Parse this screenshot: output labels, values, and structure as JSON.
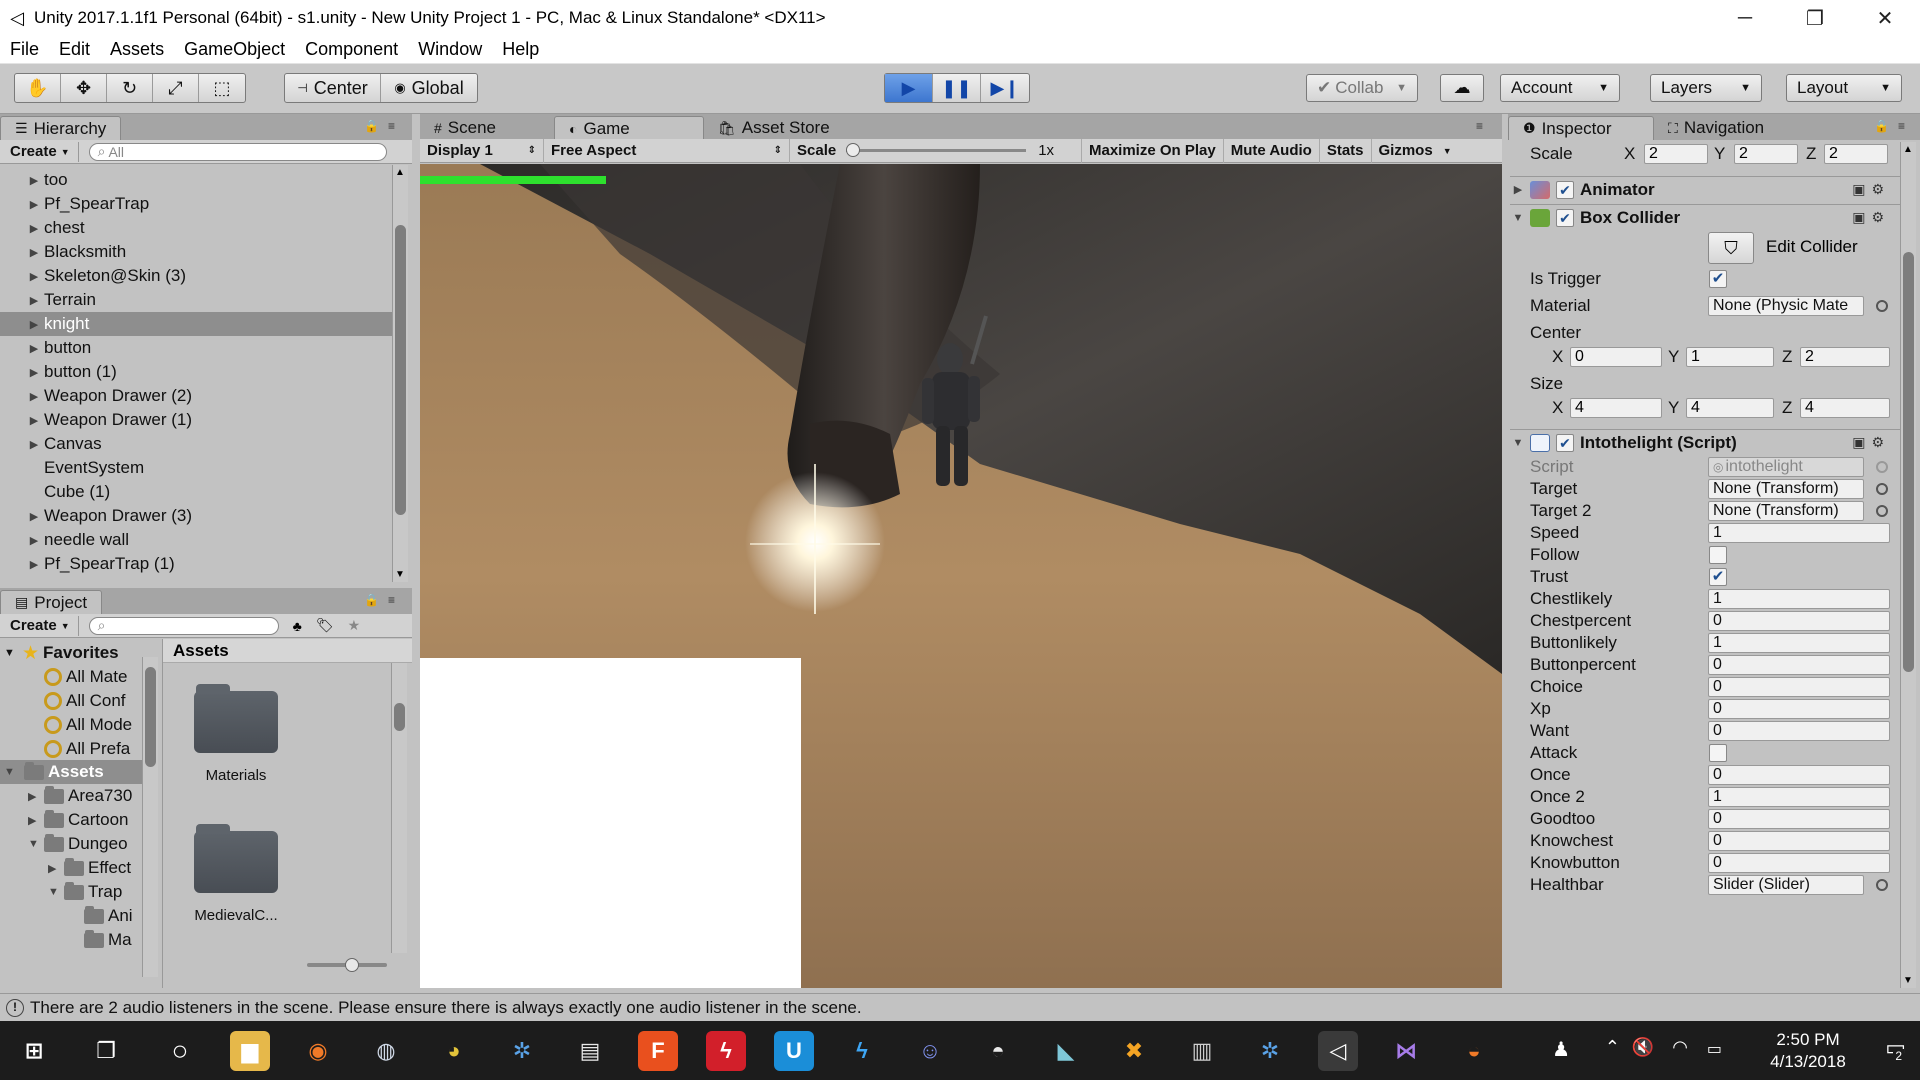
{
  "window": {
    "title": "Unity 2017.1.1f1 Personal (64bit) - s1.unity - New Unity Project 1 - PC, Mac & Linux Standalone* <DX11>",
    "minimize": "─",
    "maximize": "❐",
    "close": "✕"
  },
  "menu": [
    "File",
    "Edit",
    "Assets",
    "GameObject",
    "Component",
    "Window",
    "Help"
  ],
  "toolbar": {
    "pivot_label": "Center",
    "space_label": "Global",
    "collab_label": "Collab",
    "account_label": "Account",
    "layers_label": "Layers",
    "layout_label": "Layout"
  },
  "hierarchy": {
    "tab_label": "Hierarchy",
    "create_label": "Create",
    "search_placeholder": "All",
    "items": [
      {
        "label": "too",
        "has_children": true
      },
      {
        "label": "Pf_SpearTrap",
        "has_children": true
      },
      {
        "label": "chest",
        "has_children": true
      },
      {
        "label": "Blacksmith",
        "has_children": true
      },
      {
        "label": "Skeleton@Skin (3)",
        "has_children": true
      },
      {
        "label": "Terrain",
        "has_children": true
      },
      {
        "label": "knight",
        "has_children": true,
        "selected": true
      },
      {
        "label": "button",
        "has_children": true
      },
      {
        "label": "button (1)",
        "has_children": true
      },
      {
        "label": "Weapon Drawer (2)",
        "has_children": true
      },
      {
        "label": "Weapon Drawer (1)",
        "has_children": true
      },
      {
        "label": "Canvas",
        "has_children": true
      },
      {
        "label": "EventSystem",
        "has_children": false
      },
      {
        "label": "Cube (1)",
        "has_children": false
      },
      {
        "label": "Weapon Drawer (3)",
        "has_children": true
      },
      {
        "label": "needle wall",
        "has_children": true
      },
      {
        "label": "Pf_SpearTrap (1)",
        "has_children": true
      }
    ]
  },
  "project": {
    "tab_label": "Project",
    "create_label": "Create",
    "favorites_label": "Favorites",
    "favorites": [
      "All Mate",
      "All Conf",
      "All Mode",
      "All Prefa"
    ],
    "assets_label": "Assets",
    "tree": [
      {
        "label": "Area730",
        "indent": 1,
        "expanded": false
      },
      {
        "label": "Cartoon",
        "indent": 1,
        "expanded": false
      },
      {
        "label": "Dungeo",
        "indent": 1,
        "expanded": true
      },
      {
        "label": "Effect",
        "indent": 2,
        "expanded": false
      },
      {
        "label": "Trap",
        "indent": 2,
        "expanded": true
      },
      {
        "label": "Ani",
        "indent": 3,
        "expanded": null
      },
      {
        "label": "Ma",
        "indent": 3,
        "expanded": null
      }
    ],
    "grid_header": "Assets",
    "grid_items": [
      "Materials",
      "MedievalC..."
    ]
  },
  "center": {
    "tabs": [
      "Scene",
      "Game",
      "Asset Store"
    ],
    "active_tab": "Game",
    "display": "Display 1",
    "aspect": "Free Aspect",
    "scale_label": "Scale",
    "scale_value": "1x",
    "scale_slider": 0.0,
    "maximize_label": "Maximize On Play",
    "mute_label": "Mute Audio",
    "stats_label": "Stats",
    "gizmos_label": "Gizmos",
    "health_fraction": 1.0
  },
  "inspector": {
    "tabs": [
      "Inspector",
      "Navigation"
    ],
    "scale": {
      "label": "Scale",
      "x": "2",
      "y": "2",
      "z": "2"
    },
    "animator_label": "Animator",
    "box_collider": {
      "label": "Box Collider",
      "edit_collider": "Edit Collider",
      "is_trigger_label": "Is Trigger",
      "is_trigger": true,
      "material_label": "Material",
      "material_value": "None (Physic Mate",
      "center_label": "Center",
      "center": {
        "x": "0",
        "y": "1",
        "z": "2"
      },
      "size_label": "Size",
      "size": {
        "x": "4",
        "y": "4",
        "z": "4"
      }
    },
    "script": {
      "label": "Intothelight (Script)",
      "script_label": "Script",
      "script_value": "intothelight",
      "fields": [
        {
          "label": "Target",
          "kind": "object",
          "value": "None (Transform)"
        },
        {
          "label": "Target 2",
          "kind": "object",
          "value": "None (Transform)"
        },
        {
          "label": "Speed",
          "kind": "text",
          "value": "1"
        },
        {
          "label": "Follow",
          "kind": "check",
          "value": false
        },
        {
          "label": "Trust",
          "kind": "check",
          "value": true
        },
        {
          "label": "Chestlikely",
          "kind": "text",
          "value": "1"
        },
        {
          "label": "Chestpercent",
          "kind": "text",
          "value": "0"
        },
        {
          "label": "Buttonlikely",
          "kind": "text",
          "value": "1"
        },
        {
          "label": "Buttonpercent",
          "kind": "text",
          "value": "0"
        },
        {
          "label": "Choice",
          "kind": "text",
          "value": "0"
        },
        {
          "label": "Xp",
          "kind": "text",
          "value": "0"
        },
        {
          "label": "Want",
          "kind": "text",
          "value": "0"
        },
        {
          "label": "Attack",
          "kind": "check",
          "value": false
        },
        {
          "label": "Once",
          "kind": "text",
          "value": "0"
        },
        {
          "label": "Once 2",
          "kind": "text",
          "value": "1"
        },
        {
          "label": "Goodtoo",
          "kind": "text",
          "value": "0"
        },
        {
          "label": "Knowchest",
          "kind": "text",
          "value": "0"
        },
        {
          "label": "Knowbutton",
          "kind": "text",
          "value": "0"
        },
        {
          "label": "Healthbar",
          "kind": "object",
          "value": "Slider (Slider)"
        }
      ]
    }
  },
  "status": {
    "message": "There are 2 audio listeners in the scene. Please ensure there is always exactly one audio listener in the scene."
  },
  "taskbar": {
    "time": "2:50 PM",
    "date": "4/13/2018",
    "notification_count": "2"
  }
}
